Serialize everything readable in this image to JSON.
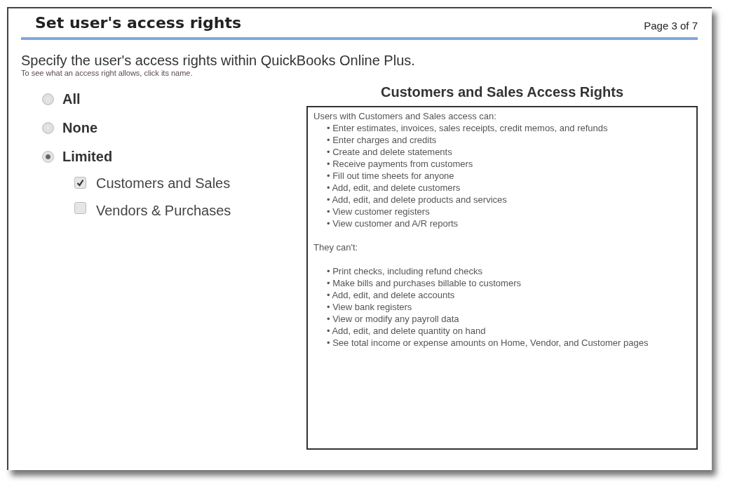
{
  "header": {
    "title": "Set user's access rights",
    "page_indicator": "Page 3 of 7"
  },
  "intro": "Specify the user's access rights within QuickBooks Online Plus.",
  "hint": "To see what an access right allows, click its name.",
  "access_levels": [
    {
      "label": "All",
      "selected": false
    },
    {
      "label": "None",
      "selected": false
    },
    {
      "label": "Limited",
      "selected": true
    }
  ],
  "areas": [
    {
      "label": "Customers and Sales",
      "checked": true
    },
    {
      "label": "Vendors & Purchases",
      "checked": false
    }
  ],
  "details": {
    "title": "Customers and Sales Access Rights",
    "can_heading": "Users with Customers and Sales access can:",
    "can": [
      "• Enter estimates, invoices, sales receipts, credit memos, and refunds",
      "• Enter charges and credits",
      "• Create and delete statements",
      "• Receive payments from customers",
      "• Fill out time sheets for anyone",
      "• Add, edit, and delete customers",
      "• Add, edit, and delete products and services",
      "• View customer registers",
      "• View customer and A/R reports"
    ],
    "cannot_heading": "They can't:",
    "cannot": [
      "• Print checks, including refund checks",
      "• Make bills and purchases billable to customers",
      "• Add, edit, and delete accounts",
      "• View bank registers",
      "• View or modify any payroll data",
      "• Add, edit, and delete quantity on hand",
      "• See total income or expense amounts on Home, Vendor, and Customer pages"
    ]
  }
}
